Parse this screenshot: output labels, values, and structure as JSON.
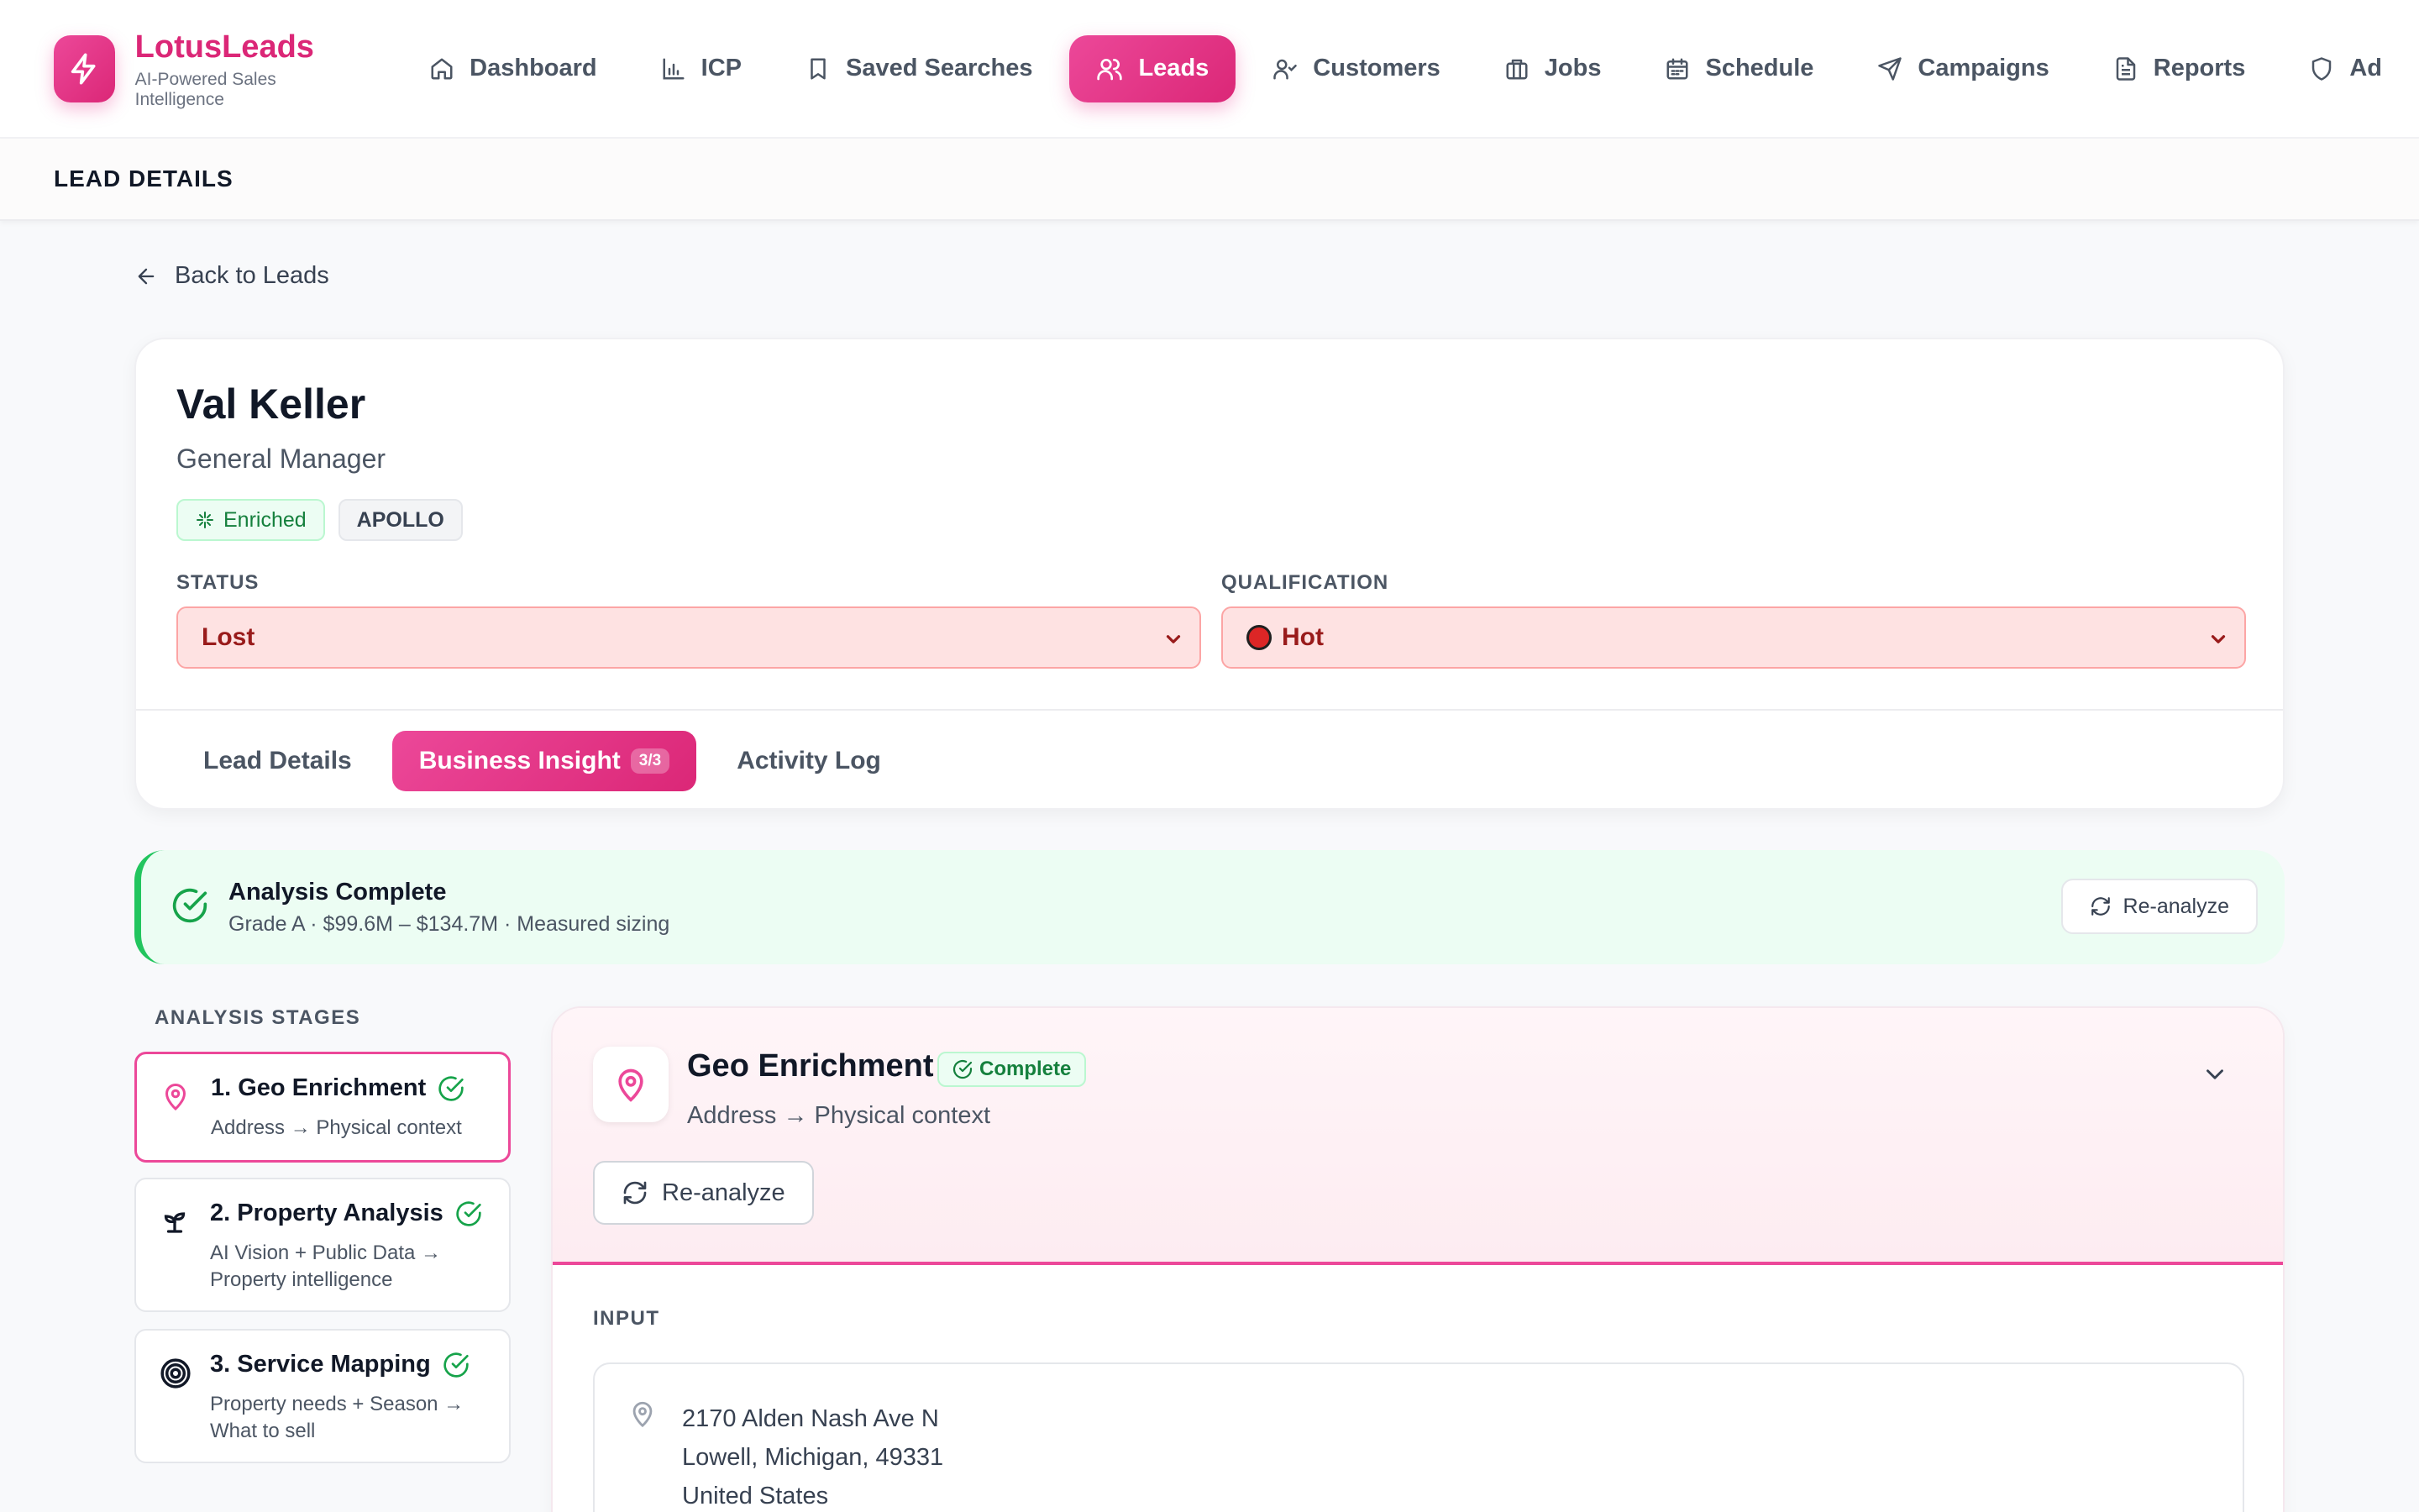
{
  "brand": {
    "name": "LotusLeads",
    "tagline": "AI-Powered Sales Intelligence"
  },
  "nav": [
    {
      "label": "Dashboard",
      "icon": "home-icon"
    },
    {
      "label": "ICP",
      "icon": "bar-chart-icon"
    },
    {
      "label": "Saved Searches",
      "icon": "bookmark-icon"
    },
    {
      "label": "Leads",
      "icon": "users-icon",
      "active": true
    },
    {
      "label": "Customers",
      "icon": "user-check-icon"
    },
    {
      "label": "Jobs",
      "icon": "briefcase-icon"
    },
    {
      "label": "Schedule",
      "icon": "calendar-icon"
    },
    {
      "label": "Campaigns",
      "icon": "send-icon"
    },
    {
      "label": "Reports",
      "icon": "file-text-icon"
    },
    {
      "label": "Ad",
      "icon": "shield-icon"
    }
  ],
  "section": {
    "title": "LEAD DETAILS"
  },
  "back_link": "Back to Leads",
  "lead": {
    "name": "Val Keller",
    "title": "General Manager",
    "badges": {
      "enriched": "Enriched",
      "source": "APOLLO"
    },
    "status_label": "STATUS",
    "status_value": "Lost",
    "qualification_label": "QUALIFICATION",
    "qualification_value": "Hot"
  },
  "tabs": [
    {
      "label": "Lead Details"
    },
    {
      "label": "Business Insight",
      "count": "3/3",
      "active": true
    },
    {
      "label": "Activity Log"
    }
  ],
  "analysis": {
    "title": "Analysis Complete",
    "summary": "Grade A · $99.6M – $134.7M · Measured sizing",
    "reanalyze_label": "Re-analyze"
  },
  "stages": {
    "heading": "ANALYSIS STAGES",
    "items": [
      {
        "title": "1. Geo Enrichment",
        "desc": "Address → Physical context",
        "icon": "map-pin-icon",
        "active": true
      },
      {
        "title": "2. Property Analysis",
        "desc": "AI Vision + Public Data → Property intelligence",
        "icon": "sprout-icon"
      },
      {
        "title": "3. Service Mapping",
        "desc": "Property needs + Season → What to sell",
        "icon": "target-icon"
      }
    ]
  },
  "panel": {
    "title": "Geo Enrichment",
    "status": "Complete",
    "subtitle": "Address → Physical context",
    "reanalyze_label": "Re-analyze",
    "input_label": "INPUT",
    "address": {
      "line1": "2170 Alden Nash Ave N",
      "line2": "Lowell, Michigan, 49331",
      "line3": "United States"
    }
  },
  "colors": {
    "accent": "#ec4899",
    "success": "#22c55e",
    "danger": "#dc2626"
  }
}
